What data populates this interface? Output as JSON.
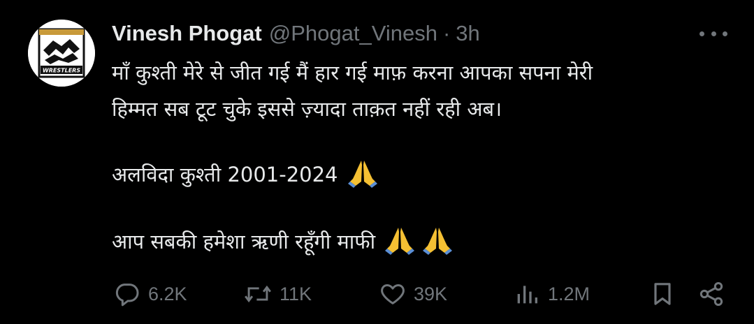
{
  "author": {
    "display_name": "Vinesh Phogat",
    "handle": "@Phogat_Vinesh",
    "separator": "·",
    "time": "3h",
    "avatar_text": "WRESTLERS"
  },
  "tweet": {
    "line1": "माँ कुश्ती मेरे से जीत गई मैं हार गई माफ़ करना आपका सपना मेरी",
    "line2": "हिम्मत सब टूट चुके इससे ज़्यादा ताक़त नहीं रही अब।",
    "line3": "अलविदा कुश्ती 2001-2024",
    "line4": "आप सबकी हमेशा ऋणी रहूँगी माफी",
    "emoji": "folded-hands-emoji"
  },
  "actions": {
    "replies": "6.2K",
    "retweets": "11K",
    "likes": "39K",
    "views": "1.2M"
  },
  "icons": {
    "reply": "reply-icon",
    "retweet": "retweet-icon",
    "like": "heart-icon",
    "views": "views-icon",
    "bookmark": "bookmark-icon",
    "share": "share-icon",
    "more": "more-icon"
  },
  "colors": {
    "background": "#000000",
    "text": "#e7e9ea",
    "secondary": "#71767b",
    "emoji": "#f5c033"
  }
}
